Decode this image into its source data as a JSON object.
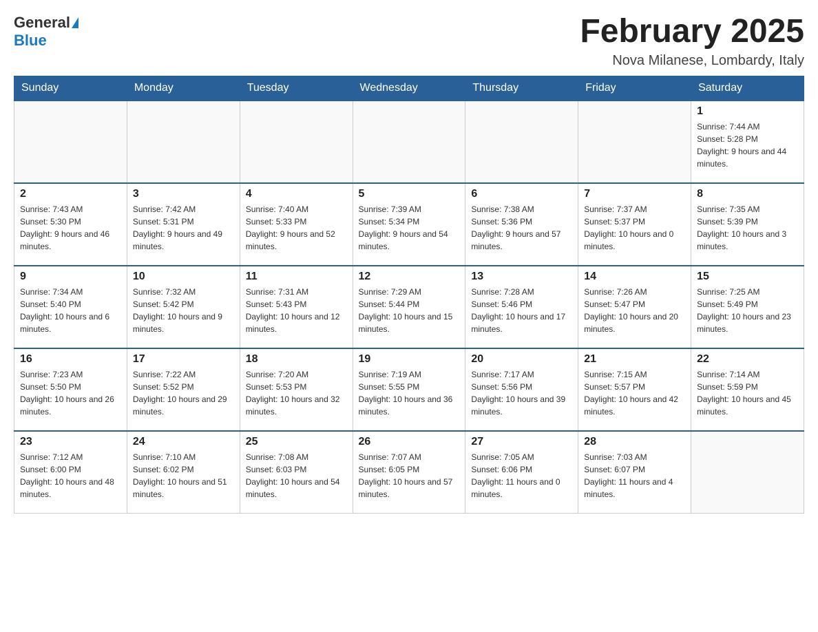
{
  "header": {
    "logo_general": "General",
    "logo_blue": "Blue",
    "title": "February 2025",
    "subtitle": "Nova Milanese, Lombardy, Italy"
  },
  "weekdays": [
    "Sunday",
    "Monday",
    "Tuesday",
    "Wednesday",
    "Thursday",
    "Friday",
    "Saturday"
  ],
  "weeks": [
    [
      {
        "day": "",
        "info": ""
      },
      {
        "day": "",
        "info": ""
      },
      {
        "day": "",
        "info": ""
      },
      {
        "day": "",
        "info": ""
      },
      {
        "day": "",
        "info": ""
      },
      {
        "day": "",
        "info": ""
      },
      {
        "day": "1",
        "info": "Sunrise: 7:44 AM\nSunset: 5:28 PM\nDaylight: 9 hours and 44 minutes."
      }
    ],
    [
      {
        "day": "2",
        "info": "Sunrise: 7:43 AM\nSunset: 5:30 PM\nDaylight: 9 hours and 46 minutes."
      },
      {
        "day": "3",
        "info": "Sunrise: 7:42 AM\nSunset: 5:31 PM\nDaylight: 9 hours and 49 minutes."
      },
      {
        "day": "4",
        "info": "Sunrise: 7:40 AM\nSunset: 5:33 PM\nDaylight: 9 hours and 52 minutes."
      },
      {
        "day": "5",
        "info": "Sunrise: 7:39 AM\nSunset: 5:34 PM\nDaylight: 9 hours and 54 minutes."
      },
      {
        "day": "6",
        "info": "Sunrise: 7:38 AM\nSunset: 5:36 PM\nDaylight: 9 hours and 57 minutes."
      },
      {
        "day": "7",
        "info": "Sunrise: 7:37 AM\nSunset: 5:37 PM\nDaylight: 10 hours and 0 minutes."
      },
      {
        "day": "8",
        "info": "Sunrise: 7:35 AM\nSunset: 5:39 PM\nDaylight: 10 hours and 3 minutes."
      }
    ],
    [
      {
        "day": "9",
        "info": "Sunrise: 7:34 AM\nSunset: 5:40 PM\nDaylight: 10 hours and 6 minutes."
      },
      {
        "day": "10",
        "info": "Sunrise: 7:32 AM\nSunset: 5:42 PM\nDaylight: 10 hours and 9 minutes."
      },
      {
        "day": "11",
        "info": "Sunrise: 7:31 AM\nSunset: 5:43 PM\nDaylight: 10 hours and 12 minutes."
      },
      {
        "day": "12",
        "info": "Sunrise: 7:29 AM\nSunset: 5:44 PM\nDaylight: 10 hours and 15 minutes."
      },
      {
        "day": "13",
        "info": "Sunrise: 7:28 AM\nSunset: 5:46 PM\nDaylight: 10 hours and 17 minutes."
      },
      {
        "day": "14",
        "info": "Sunrise: 7:26 AM\nSunset: 5:47 PM\nDaylight: 10 hours and 20 minutes."
      },
      {
        "day": "15",
        "info": "Sunrise: 7:25 AM\nSunset: 5:49 PM\nDaylight: 10 hours and 23 minutes."
      }
    ],
    [
      {
        "day": "16",
        "info": "Sunrise: 7:23 AM\nSunset: 5:50 PM\nDaylight: 10 hours and 26 minutes."
      },
      {
        "day": "17",
        "info": "Sunrise: 7:22 AM\nSunset: 5:52 PM\nDaylight: 10 hours and 29 minutes."
      },
      {
        "day": "18",
        "info": "Sunrise: 7:20 AM\nSunset: 5:53 PM\nDaylight: 10 hours and 32 minutes."
      },
      {
        "day": "19",
        "info": "Sunrise: 7:19 AM\nSunset: 5:55 PM\nDaylight: 10 hours and 36 minutes."
      },
      {
        "day": "20",
        "info": "Sunrise: 7:17 AM\nSunset: 5:56 PM\nDaylight: 10 hours and 39 minutes."
      },
      {
        "day": "21",
        "info": "Sunrise: 7:15 AM\nSunset: 5:57 PM\nDaylight: 10 hours and 42 minutes."
      },
      {
        "day": "22",
        "info": "Sunrise: 7:14 AM\nSunset: 5:59 PM\nDaylight: 10 hours and 45 minutes."
      }
    ],
    [
      {
        "day": "23",
        "info": "Sunrise: 7:12 AM\nSunset: 6:00 PM\nDaylight: 10 hours and 48 minutes."
      },
      {
        "day": "24",
        "info": "Sunrise: 7:10 AM\nSunset: 6:02 PM\nDaylight: 10 hours and 51 minutes."
      },
      {
        "day": "25",
        "info": "Sunrise: 7:08 AM\nSunset: 6:03 PM\nDaylight: 10 hours and 54 minutes."
      },
      {
        "day": "26",
        "info": "Sunrise: 7:07 AM\nSunset: 6:05 PM\nDaylight: 10 hours and 57 minutes."
      },
      {
        "day": "27",
        "info": "Sunrise: 7:05 AM\nSunset: 6:06 PM\nDaylight: 11 hours and 0 minutes."
      },
      {
        "day": "28",
        "info": "Sunrise: 7:03 AM\nSunset: 6:07 PM\nDaylight: 11 hours and 4 minutes."
      },
      {
        "day": "",
        "info": ""
      }
    ]
  ]
}
